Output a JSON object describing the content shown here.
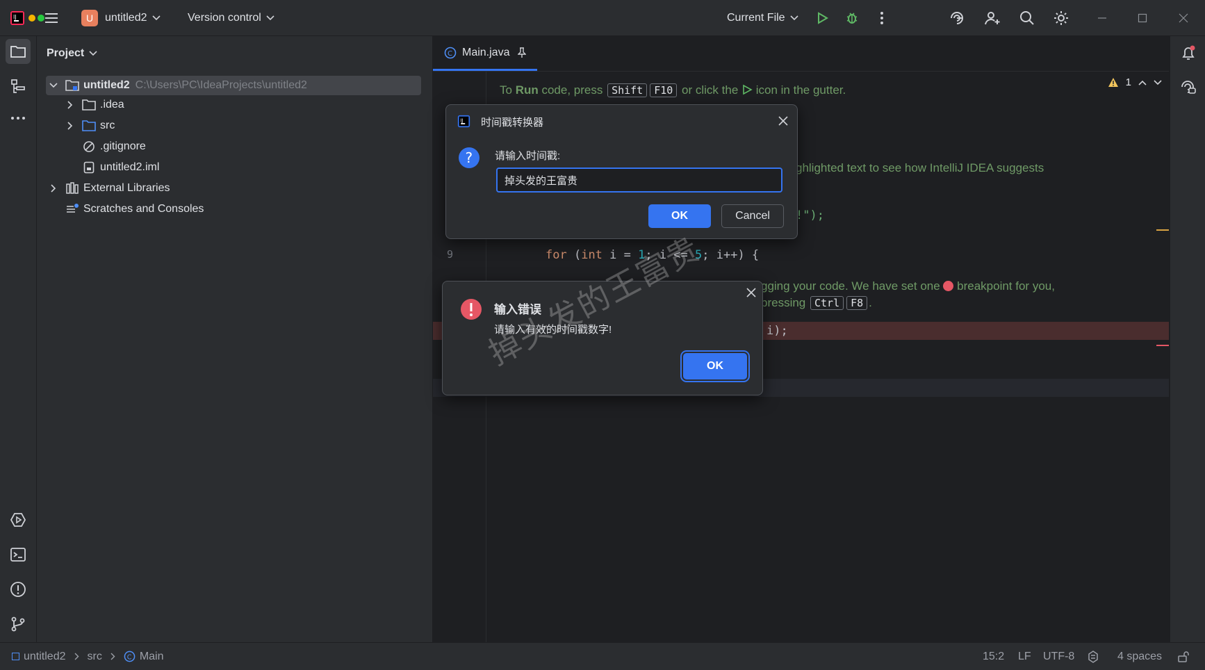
{
  "titlebar": {
    "project_initial": "U",
    "project_name": "untitled2",
    "vcs_label": "Version control",
    "run_config": "Current File"
  },
  "project_panel": {
    "title": "Project",
    "tree": [
      {
        "label": "untitled2",
        "path": "C:\\Users\\PC\\IdeaProjects\\untitled2",
        "icon": "module-folder-icon"
      },
      {
        "label": ".idea",
        "icon": "folder-icon"
      },
      {
        "label": "src",
        "icon": "folder-icon"
      },
      {
        "label": ".gitignore",
        "icon": "ignore-file-icon"
      },
      {
        "label": "untitled2.iml",
        "icon": "iml-file-icon"
      },
      {
        "label": "External Libraries",
        "icon": "library-icon"
      },
      {
        "label": "Scratches and Consoles",
        "icon": "scratches-icon"
      }
    ]
  },
  "editor": {
    "tab_label": "Main.java",
    "warning_count": "1",
    "line_number_9": "9",
    "doc1": {
      "pre": "To ",
      "run": "Run",
      "mid": " code, press ",
      "key1": "Shift",
      "key2": "F10",
      "post1": " or click the ",
      "post2": " icon in the gutter."
    },
    "doc2": "ghlighted text to see how IntelliJ IDEA suggests",
    "code_string_tail": "!\");",
    "code_for": {
      "kw_for": "for",
      "open": " (",
      "kw_int": "int",
      "var1": " i = ",
      "n1": "1",
      "semi1": "; i <= ",
      "n2": "5",
      "tail": "; i++) {"
    },
    "doc3": {
      "pre": "gging your code. We have set one ",
      "post": " breakpoint for you,"
    },
    "doc4": {
      "pre": "pressing ",
      "key1": "Ctrl",
      "key2": "F8",
      "post": "."
    },
    "code_bp": "i);"
  },
  "timestamp_dialog": {
    "title": "时间戳转换器",
    "prompt": "请输入时间戳:",
    "input_value": "掉头发的王富贵",
    "ok_label": "OK",
    "cancel_label": "Cancel"
  },
  "error_dialog": {
    "title": "输入错误",
    "message": "请输入有效的时间戳数字!",
    "ok_label": "OK"
  },
  "watermark": "掉头发的王富贵",
  "statusbar": {
    "crumbs": [
      "untitled2",
      "src",
      "Main"
    ],
    "position": "15:2",
    "line_sep": "LF",
    "encoding": "UTF-8",
    "indent": "4 spaces"
  },
  "colors": {
    "accent": "#3574f0",
    "error": "#e55765",
    "run_green": "#5fb865",
    "warning": "#f2c55c"
  }
}
